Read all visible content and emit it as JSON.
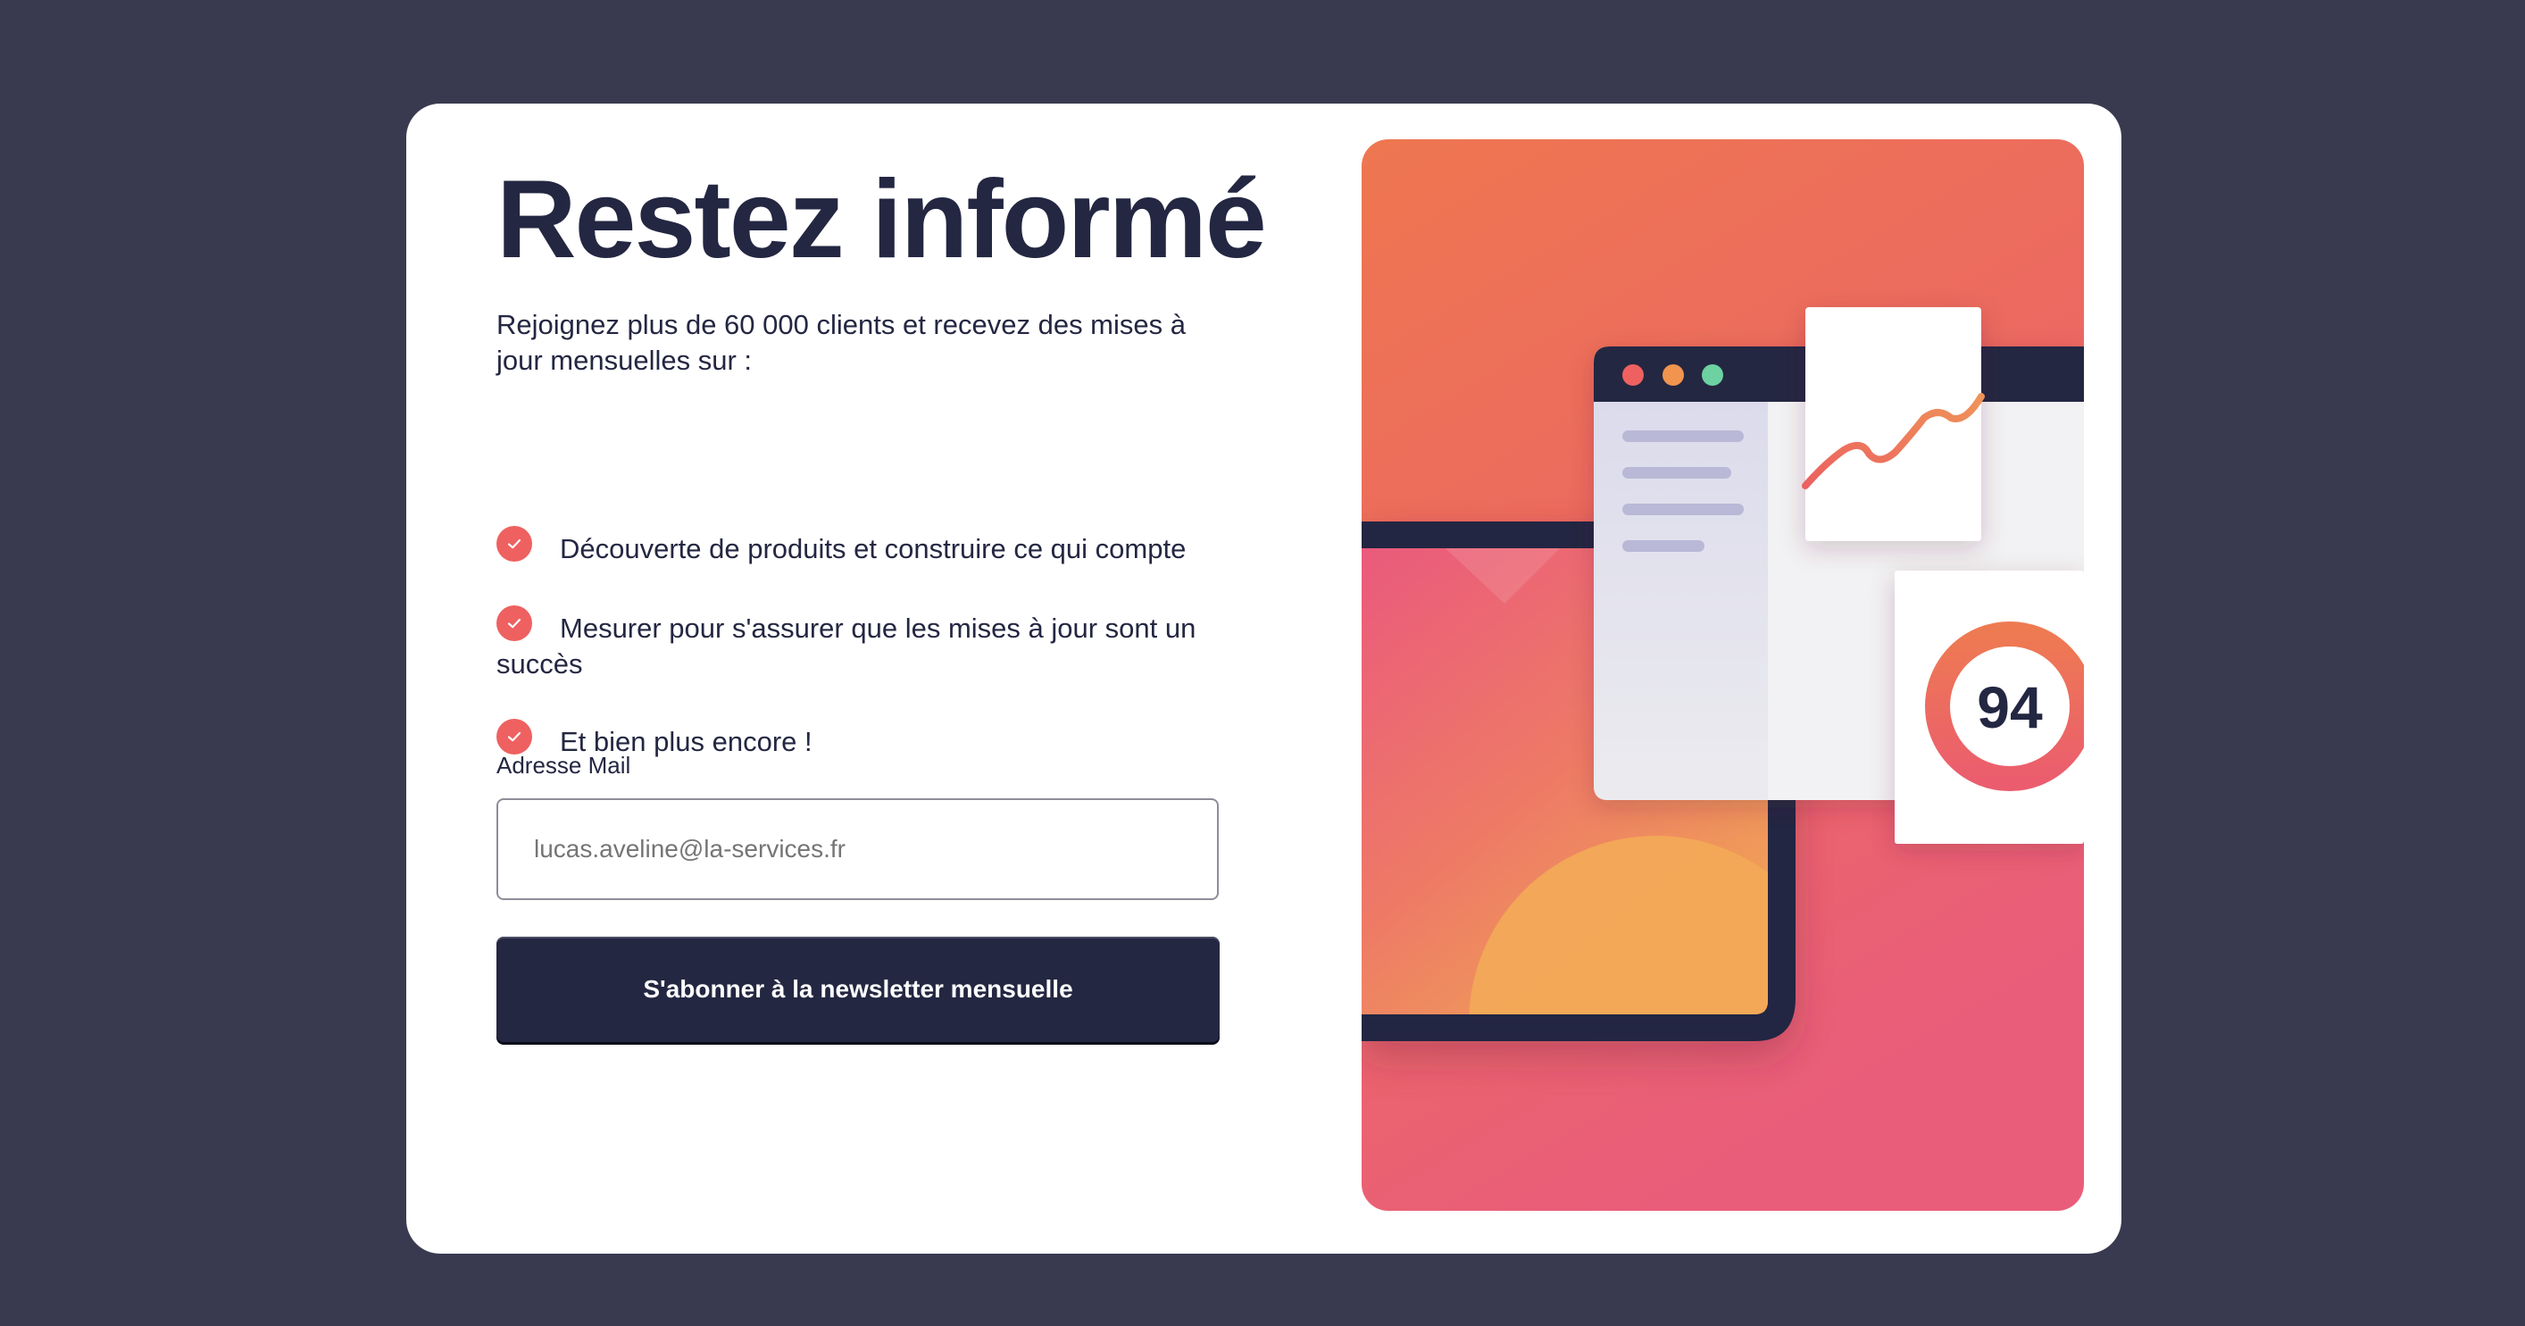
{
  "newsletter": {
    "title": "Restez informé",
    "intro": "Rejoignez plus de 60 000 clients et recevez des mises à jour mensuelles sur :",
    "features": [
      {
        "text": "Découverte de produits et construire ce qui compte"
      },
      {
        "text": "Mesurer pour s'assurer que les mises à jour sont un succès"
      },
      {
        "text": "Et bien plus encore !"
      }
    ],
    "email_label": "Adresse Mail",
    "email_placeholder": "lucas.aveline@la-services.fr",
    "submit_label": "S'abonner à la newsletter mensuelle"
  },
  "illustration": {
    "score": "94",
    "score_progress": 0.94
  },
  "colors": {
    "page_background": "#393a4f",
    "card_background": "#ffffff",
    "primary": "#242742",
    "accent_red": "#ee6160",
    "accent_orange": "#f0a356",
    "accent_pink": "#eb5d7b",
    "dot_green": "#6dd1a1"
  },
  "icons": {
    "feature_check": "check-circle-icon",
    "illustration": "dashboard-illustration"
  }
}
